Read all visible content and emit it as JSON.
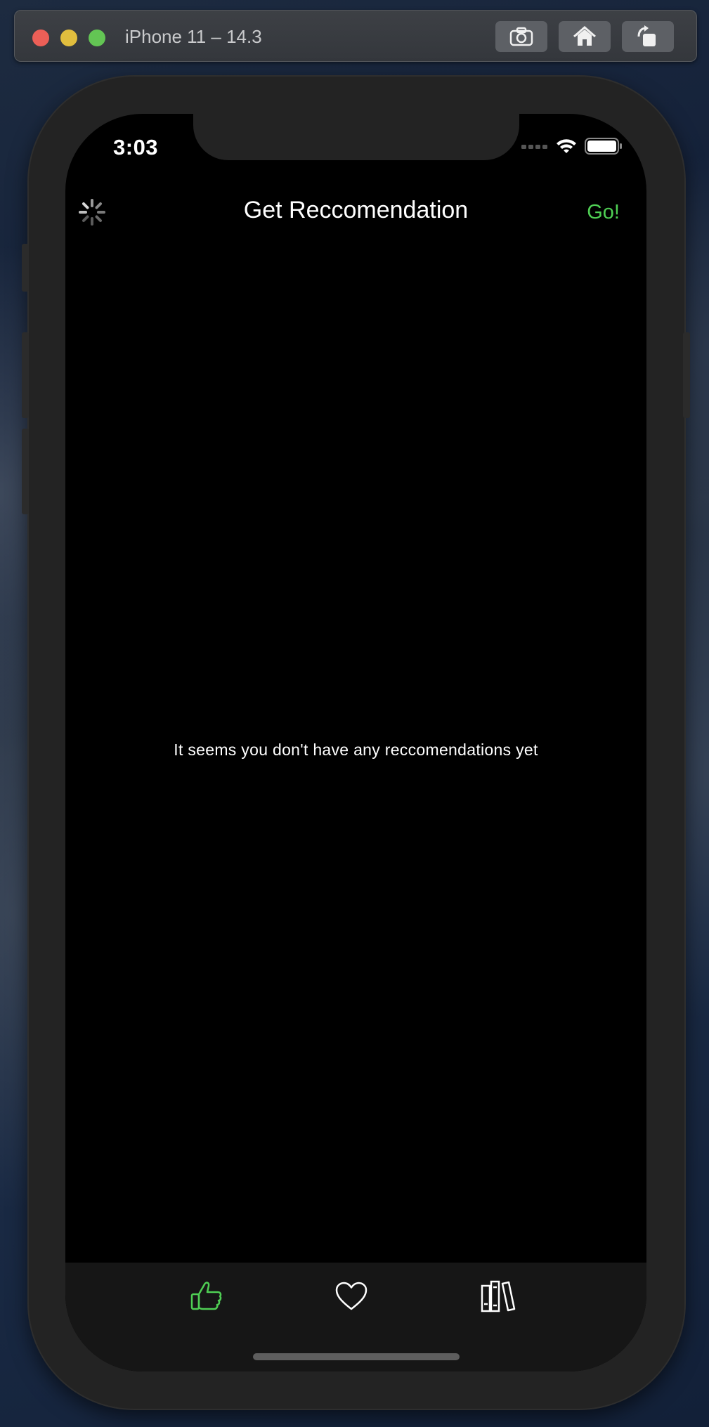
{
  "window": {
    "title": "iPhone 11 – 14.3",
    "toolbar_buttons": [
      "screenshot-icon",
      "home-icon",
      "rotate-icon"
    ]
  },
  "status_bar": {
    "time": "3:03",
    "icons": [
      "cellular-icon",
      "wifi-icon",
      "battery-icon"
    ]
  },
  "nav": {
    "title": "Get Reccomendation",
    "go_label": "Go!",
    "left_icon": "activity-spinner-icon"
  },
  "main": {
    "empty_message": "It seems you don't have any reccomendations yet"
  },
  "tab_bar": {
    "items": [
      {
        "icon": "thumbs-up-icon",
        "selected": true
      },
      {
        "icon": "heart-icon",
        "selected": false
      },
      {
        "icon": "books-icon",
        "selected": false
      }
    ]
  },
  "colors": {
    "accent": "#4fcf54",
    "background": "#000000",
    "tab_bar": "#161616"
  }
}
